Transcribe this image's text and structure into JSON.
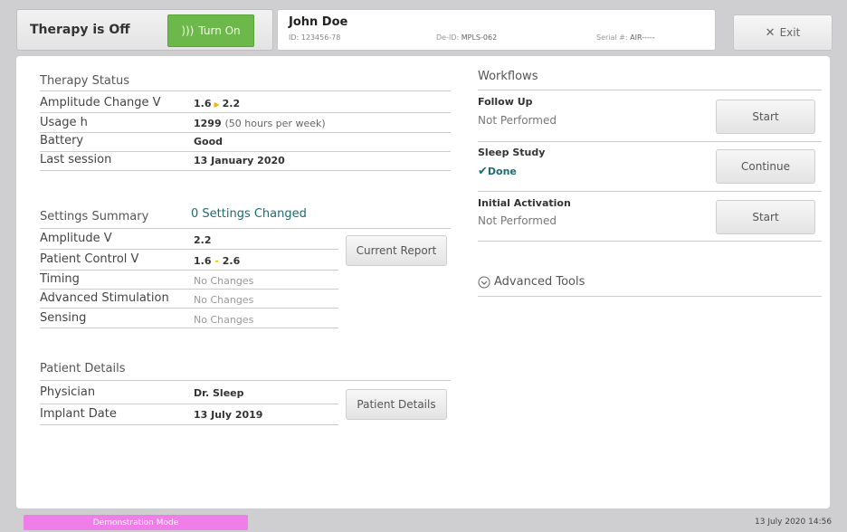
{
  "header": {
    "therapy_status": "Therapy is Off",
    "turn_on_label": "Turn On",
    "patient_name": "John Doe",
    "patient_id": "ID: 123456-78",
    "deid_label": "De-ID:",
    "deid_value": "MPLS-062",
    "serial_label": "Serial #:",
    "serial_value": "AIR-----",
    "exit_label": "Exit"
  },
  "therapy_status": {
    "title": "Therapy Status",
    "rows": [
      {
        "label": "Amplitude Change V",
        "from": "1.6",
        "to": "2.2"
      },
      {
        "label": "Usage h",
        "value": "1299",
        "note": "(50 hours per week)"
      },
      {
        "label": "Battery",
        "value": "Good"
      },
      {
        "label": "Last session",
        "value": "13 January 2020"
      }
    ]
  },
  "settings_summary": {
    "title": "Settings Summary",
    "changed_link": "0 Settings Changed",
    "report_button": "Current Report",
    "rows": [
      {
        "label": "Amplitude V",
        "value": "2.2"
      },
      {
        "label": "Patient Control V",
        "from": "1.6",
        "sep": "-",
        "to": "2.6"
      },
      {
        "label": "Timing",
        "value": "No Changes"
      },
      {
        "label": "Advanced Stimulation",
        "value": "No Changes"
      },
      {
        "label": "Sensing",
        "value": "No Changes"
      }
    ]
  },
  "patient_details": {
    "title": "Patient Details",
    "button": "Patient Details",
    "rows": [
      {
        "label": "Physician",
        "value": "Dr. Sleep"
      },
      {
        "label": "Implant Date",
        "value": "13 July 2019"
      }
    ]
  },
  "workflows": {
    "title": "Workflows",
    "items": [
      {
        "name": "Follow Up",
        "status": "Not Performed",
        "button": "Start"
      },
      {
        "name": "Sleep Study",
        "status": "Done",
        "button": "Continue"
      },
      {
        "name": "Initial Activation",
        "status": "Not Performed",
        "button": "Start"
      }
    ],
    "advanced_tools": "Advanced Tools"
  },
  "footer": {
    "demo_mode": "Demonstration Mode",
    "datetime": "13 July 2020 14:56"
  },
  "colors": {
    "turn_on_green": "#6cb84a",
    "link_teal": "#1d6b73",
    "demo_pink": "#f07ee9",
    "arrow_yellow": "#f5b400"
  },
  "icons": {
    "turn_on": "radio-waves-icon",
    "exit": "close-icon",
    "done": "checkmark-icon",
    "advanced_tools": "chevron-circle-down-icon"
  }
}
